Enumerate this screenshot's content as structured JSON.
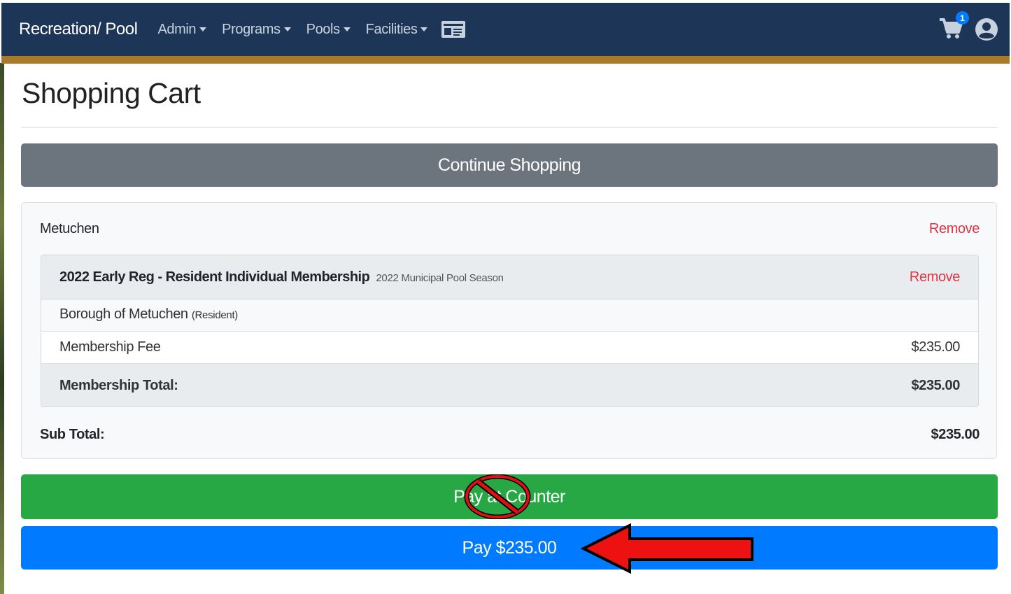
{
  "navbar": {
    "brand": "Recreation/ Pool",
    "menu": [
      {
        "label": "Admin"
      },
      {
        "label": "Programs"
      },
      {
        "label": "Pools"
      },
      {
        "label": "Facilities"
      }
    ],
    "icons": [
      "id-card-icon",
      "shopping-cart-icon",
      "user-circle-icon"
    ],
    "cart_count": "1",
    "colors": {
      "background": "#1d3658",
      "accent": "#a87a2a"
    }
  },
  "page": {
    "title": "Shopping Cart"
  },
  "buttons": {
    "continue_shopping": "Continue Shopping",
    "pay_at_counter": "Pay at Counter",
    "pay": "Pay $235.00"
  },
  "cart": {
    "vendor": "Metuchen",
    "remove_label": "Remove",
    "item": {
      "title": "2022 Early Reg - Resident Individual Membership",
      "subtitle": "2022 Municipal Pool Season",
      "remove_label": "Remove",
      "organization": "Borough of Metuchen",
      "organization_note": "(Resident)",
      "fee_label": "Membership Fee",
      "fee_value": "$235.00",
      "total_label": "Membership Total:",
      "total_value": "$235.00"
    },
    "subtotal_label": "Sub Total:",
    "subtotal_value": "$235.00"
  },
  "annotations": [
    "no-symbol-icon",
    "left-arrow-icon"
  ]
}
